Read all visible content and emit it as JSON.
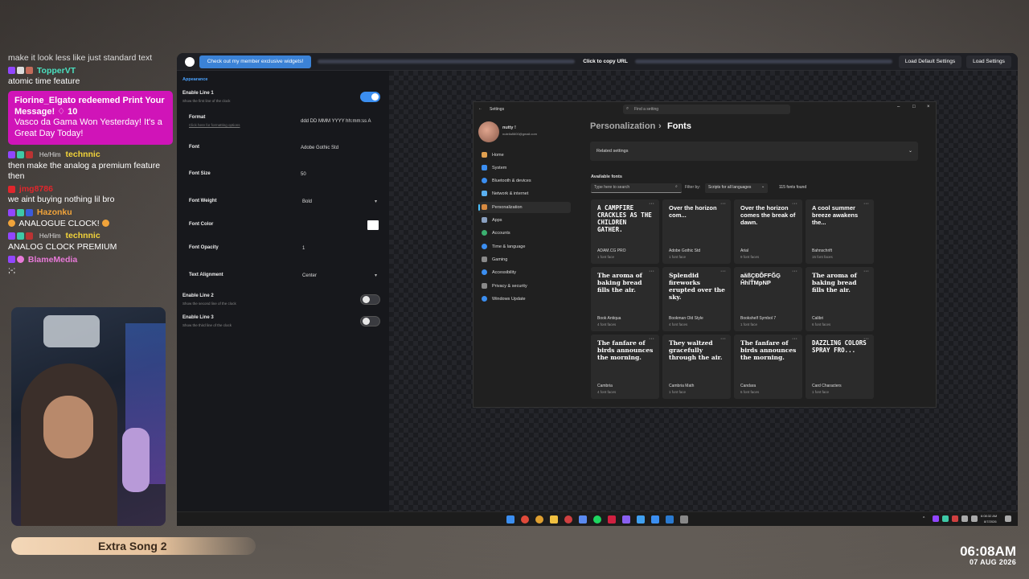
{
  "chat": {
    "lines": [
      {
        "user": "",
        "text": "make it look less like just standard text",
        "color": "#888888"
      },
      {
        "user": "TopperVT",
        "text": "atomic time feature",
        "color": "#4be0c0"
      },
      {
        "user": "technnic",
        "text": "then make the analog a premium feature then",
        "color": "#f2d33a",
        "pronoun": "He/Him"
      },
      {
        "user": "jmg8786",
        "text": "we aint buying nothing lil bro",
        "color": "#e0262c"
      },
      {
        "user": "Hazonku",
        "text": "ANALOGUE CLOCK!",
        "color": "#f0a33a"
      },
      {
        "user": "technnic",
        "text": "ANALOG CLOCK PREMIUM",
        "color": "#f2d33a",
        "pronoun": "He/Him"
      },
      {
        "user": "BlameMedia",
        "text": ";-;",
        "color": "#e879d8"
      }
    ],
    "redeem": {
      "title": "Fiorine_Elgato redeemed Print Your Message! ♢ 10",
      "body": "Vasco da Gama Won Yesterday! It's a Great Day Today!"
    }
  },
  "song": {
    "label": "Extra Song 2"
  },
  "overlay_clock": {
    "time": "06:08AM",
    "date": "07 AUG 2026"
  },
  "app": {
    "member_button": "Check out my member exclusive widgets!",
    "copy_url": "Click to copy URL",
    "load_default": "Load Default Settings",
    "load_settings": "Load Settings",
    "panel": {
      "section": "Appearance",
      "enable_line1": {
        "label": "Enable Line 1",
        "sub": "Show the first line of the clock",
        "on": true
      },
      "format": {
        "label": "Format",
        "link": "Click here for formatting options",
        "value": "ddd DD MMM YYYY hh:mm:ss A"
      },
      "font": {
        "label": "Font",
        "value": "Adobe Gothic Std"
      },
      "font_size": {
        "label": "Font Size",
        "value": "50"
      },
      "font_weight": {
        "label": "Font Weight",
        "value": "Bold"
      },
      "font_color": {
        "label": "Font Color",
        "value": "#ffffff"
      },
      "font_opacity": {
        "label": "Font Opacity",
        "value": "1"
      },
      "text_alignment": {
        "label": "Text Alignment",
        "value": "Center"
      },
      "enable_line2": {
        "label": "Enable Line 2",
        "sub": "Show the second line of the clock",
        "on": false
      },
      "enable_line3": {
        "label": "Enable Line 3",
        "sub": "Show the third line of the clock",
        "on": false
      }
    }
  },
  "win_settings": {
    "title": "Settings",
    "search_placeholder": "Find a setting",
    "user_name": "nutty !",
    "user_email": "nutella5600@gmail.com",
    "breadcrumb_parent": "Personalization",
    "breadcrumb_current": "Fonts",
    "related": "Related settings",
    "available": "Available fonts",
    "font_search_placeholder": "Type here to search",
    "filter_label": "Filter by:",
    "filter_value": "Scripts for all languages",
    "fonts_found": "115 fonts found",
    "nav": [
      "Home",
      "System",
      "Bluetooth & devices",
      "Network & internet",
      "Personalization",
      "Apps",
      "Accounts",
      "Time & language",
      "Gaming",
      "Accessibility",
      "Privacy & security",
      "Windows Update"
    ],
    "fonts": [
      {
        "sample": "A CAMPFIRE CRACKLES AS THE CHILDREN GATHER.",
        "name": "ADAM.CG PRO",
        "faces": "1 font face"
      },
      {
        "sample": "Over the horizon com...",
        "name": "Adobe Gothic Std",
        "faces": "1 font face"
      },
      {
        "sample": "Over the horizon comes the break of dawn.",
        "name": "Arial",
        "faces": "9 font faces"
      },
      {
        "sample": "A cool summer breeze awakens the...",
        "name": "Bahnschrift",
        "faces": "15 font faces"
      },
      {
        "sample": "The aroma of baking bread fills the air.",
        "name": "Book Antiqua",
        "faces": "4 font faces"
      },
      {
        "sample": "Splendid fireworks erupted over the sky.",
        "name": "Bookman Old Style",
        "faces": "4 font faces"
      },
      {
        "sample": "aăßÇĐĎFFĞĢ ĤhİŤMpNP",
        "name": "Bookshelf Symbol 7",
        "faces": "1 font face"
      },
      {
        "sample": "The aroma of baking bread fills the air.",
        "name": "Calibri",
        "faces": "6 font faces"
      },
      {
        "sample": "The fanfare of birds announces the morning.",
        "name": "Cambria",
        "faces": "4 font faces"
      },
      {
        "sample": "They waltzed gracefully through the air.",
        "name": "Cambria Math",
        "faces": "1 font face"
      },
      {
        "sample": "The fanfare of birds announces the morning.",
        "name": "Candara",
        "faces": "6 font faces"
      },
      {
        "sample": "DAZZLING COLORS SPRAY FRO...",
        "name": "Card Characters",
        "faces": "1 font face"
      }
    ]
  },
  "taskbar": {
    "time": "6:08:32 AM",
    "date": "8/7/2026"
  }
}
